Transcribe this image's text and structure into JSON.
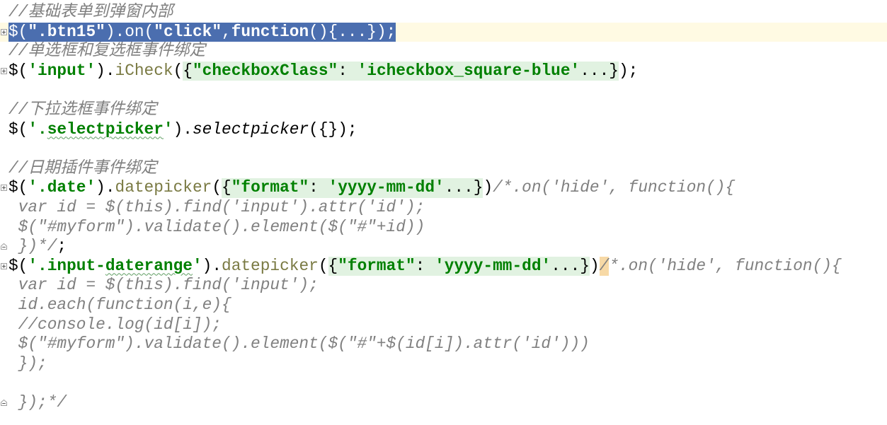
{
  "editor": {
    "colors": {
      "plain": "#000000",
      "comment": "#808080",
      "string": "#008000",
      "keyword": "#000080",
      "method": "#7a7a43",
      "selection_bg": "#4b6eaf",
      "selection_text": "#ffffff",
      "current_line_bg": "#fffae3",
      "fold_placeholder_bg": "#e1f2e1",
      "brace_match_bg": "#f7d9a6",
      "typo_underline": "#5f9e62"
    },
    "lines": [
      {
        "tokens": [
          {
            "t": "//基础表单到弹窗内部",
            "k": "comment"
          }
        ]
      },
      {
        "fold": "fold-expand-icon",
        "current": true,
        "selected": true,
        "tokens": [
          {
            "t": "$(",
            "k": "plain"
          },
          {
            "t": "\".btn15\"",
            "k": "str"
          },
          {
            "t": ").",
            "k": "plain"
          },
          {
            "t": "on",
            "k": "method"
          },
          {
            "t": "(",
            "k": "plain"
          },
          {
            "t": "\"click\"",
            "k": "str"
          },
          {
            "t": ",",
            "k": "plain"
          },
          {
            "t": "function",
            "k": "keyword"
          },
          {
            "t": "()",
            "k": "plain"
          },
          {
            "region": [
              {
                "t": "{...}",
                "k": "plain"
              }
            ]
          },
          {
            "t": ");",
            "k": "plain"
          }
        ]
      },
      {
        "tokens": [
          {
            "t": "//单选框和复选框事件绑定",
            "k": "comment"
          }
        ]
      },
      {
        "fold": "fold-expand-icon",
        "tokens": [
          {
            "t": "$(",
            "k": "plain"
          },
          {
            "t": "'input'",
            "k": "str"
          },
          {
            "t": ").",
            "k": "plain"
          },
          {
            "t": "iCheck",
            "k": "method"
          },
          {
            "t": "(",
            "k": "plain"
          },
          {
            "region": [
              {
                "t": "{",
                "k": "plain"
              },
              {
                "t": "\"checkboxClass\"",
                "k": "key"
              },
              {
                "t": ": ",
                "k": "plain"
              },
              {
                "t": "'icheckbox_square-blue'",
                "k": "str"
              },
              {
                "t": "...}",
                "k": "plain"
              }
            ]
          },
          {
            "t": ");",
            "k": "plain"
          }
        ]
      },
      {
        "tokens": []
      },
      {
        "tokens": [
          {
            "t": "//下拉选框事件绑定",
            "k": "comment"
          }
        ]
      },
      {
        "tokens": [
          {
            "t": "$(",
            "k": "plain"
          },
          {
            "t": "'.",
            "k": "str"
          },
          {
            "t": "selectpicker",
            "k": "str",
            "typo": true
          },
          {
            "t": "'",
            "k": "str"
          },
          {
            "t": ").",
            "k": "plain"
          },
          {
            "t": "selectpicker",
            "k": "italic"
          },
          {
            "t": "({});",
            "k": "plain"
          }
        ]
      },
      {
        "tokens": []
      },
      {
        "tokens": [
          {
            "t": "//日期插件事件绑定",
            "k": "comment"
          }
        ]
      },
      {
        "fold": "fold-expand-icon",
        "tokens": [
          {
            "t": "$(",
            "k": "plain"
          },
          {
            "t": "'.date'",
            "k": "str"
          },
          {
            "t": ").",
            "k": "plain"
          },
          {
            "t": "datepicker",
            "k": "method"
          },
          {
            "t": "(",
            "k": "plain"
          },
          {
            "region": [
              {
                "t": "{",
                "k": "plain"
              },
              {
                "t": "\"format\"",
                "k": "key"
              },
              {
                "t": ": ",
                "k": "plain"
              },
              {
                "t": "'yyyy-mm-dd'",
                "k": "str"
              },
              {
                "t": "...}",
                "k": "plain"
              }
            ]
          },
          {
            "t": ")",
            "k": "plain"
          },
          {
            "t": "/*.on('hide', function(){",
            "k": "comment"
          }
        ]
      },
      {
        "tokens": [
          {
            "t": " var id = $(this).find('input').attr('id');",
            "k": "comment"
          }
        ]
      },
      {
        "tokens": [
          {
            "t": " $(\"#myform\").validate().element($(\"#\"+id))",
            "k": "comment"
          }
        ]
      },
      {
        "fold": "fold-end-icon",
        "tokens": [
          {
            "t": " })*/",
            "k": "comment"
          },
          {
            "t": ";",
            "k": "plain"
          }
        ]
      },
      {
        "fold": "fold-expand-icon",
        "tokens": [
          {
            "t": "$(",
            "k": "plain"
          },
          {
            "t": "'.input-",
            "k": "str"
          },
          {
            "t": "daterange",
            "k": "str",
            "typo": true
          },
          {
            "t": "'",
            "k": "str"
          },
          {
            "t": ").",
            "k": "plain"
          },
          {
            "t": "datepicker",
            "k": "method"
          },
          {
            "t": "(",
            "k": "plain"
          },
          {
            "region": [
              {
                "t": "{",
                "k": "plain"
              },
              {
                "t": "\"format\"",
                "k": "key"
              },
              {
                "t": ": ",
                "k": "plain"
              },
              {
                "t": "'yyyy-mm-dd'",
                "k": "str"
              },
              {
                "t": "...}",
                "k": "plain"
              }
            ]
          },
          {
            "t": ")",
            "k": "plain"
          },
          {
            "t": "/",
            "k": "comment",
            "match": true
          },
          {
            "t": "*.on('hide', function(){",
            "k": "comment"
          }
        ]
      },
      {
        "tokens": [
          {
            "t": " var id = $(this).find('input');",
            "k": "comment"
          }
        ]
      },
      {
        "tokens": [
          {
            "t": " id.each(function(i,e){",
            "k": "comment"
          }
        ]
      },
      {
        "tokens": [
          {
            "t": " //console.log(id[i]);",
            "k": "comment"
          }
        ]
      },
      {
        "tokens": [
          {
            "t": " $(\"#myform\").validate().element($(\"#\"+$(id[i]).attr('id')))",
            "k": "comment"
          }
        ]
      },
      {
        "tokens": [
          {
            "t": " });",
            "k": "comment"
          }
        ]
      },
      {
        "tokens": []
      },
      {
        "fold": "fold-end-icon",
        "tokens": [
          {
            "t": " });*/",
            "k": "comment"
          }
        ]
      }
    ]
  }
}
